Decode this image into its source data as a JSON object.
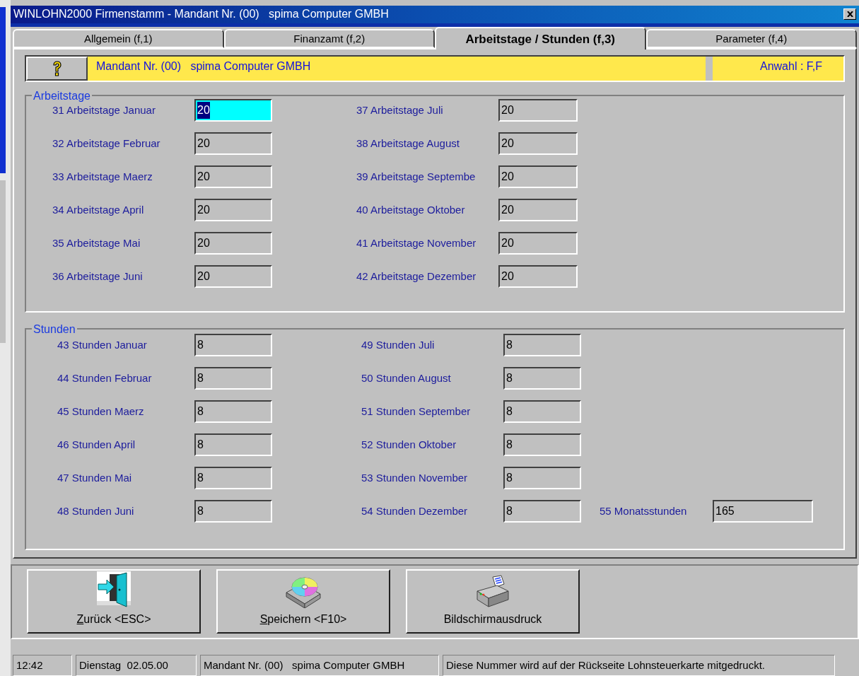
{
  "window": {
    "title": "WINLOHN2000 Firmenstamm - Mandant Nr. (00)   spima Computer GMBH"
  },
  "tabs": [
    {
      "label": "Allgemein (f,1)",
      "selected": false
    },
    {
      "label": "Finanzamt (f,2)",
      "selected": false
    },
    {
      "label": "Arbeitstage / Stunden (f,3)",
      "selected": true
    },
    {
      "label": "Parameter (f,4)",
      "selected": false
    }
  ],
  "info_bar": {
    "text": "Mandant Nr. (00)   spima Computer GMBH",
    "selection": "Anwahl : F,F"
  },
  "groups": [
    {
      "title": "Arbeitstage",
      "columns": [
        [
          {
            "label": "31 Arbeitstage Januar",
            "value": "20",
            "focused": true
          },
          {
            "label": "32 Arbeitstage Februar",
            "value": "20",
            "focused": false
          },
          {
            "label": "33 Arbeitstage Maerz",
            "value": "20",
            "focused": false
          },
          {
            "label": "34 Arbeitstage April",
            "value": "20",
            "focused": false
          },
          {
            "label": "35 Arbeitstage Mai",
            "value": "20",
            "focused": false
          },
          {
            "label": "36 Arbeitstage Juni",
            "value": "20",
            "focused": false
          }
        ],
        [
          {
            "label": "37 Arbeitstage Juli",
            "value": "20",
            "focused": false
          },
          {
            "label": "38 Arbeitstage August",
            "value": "20",
            "focused": false
          },
          {
            "label": "39 Arbeitstage Septembe",
            "value": "20",
            "focused": false
          },
          {
            "label": "40 Arbeitstage Oktober",
            "value": "20",
            "focused": false
          },
          {
            "label": "41 Arbeitstage November",
            "value": "20",
            "focused": false
          },
          {
            "label": "42 Arbeitstage Dezember",
            "value": "20",
            "focused": false
          }
        ]
      ]
    },
    {
      "title": "Stunden",
      "columns": [
        [
          {
            "label": "43 Stunden Januar",
            "value": "8",
            "focused": false
          },
          {
            "label": "44 Stunden Februar",
            "value": "8",
            "focused": false
          },
          {
            "label": "45 Stunden Maerz",
            "value": "8",
            "focused": false
          },
          {
            "label": "46 Stunden April",
            "value": "8",
            "focused": false
          },
          {
            "label": "47 Stunden Mai",
            "value": "8",
            "focused": false
          },
          {
            "label": "48 Stunden Juni",
            "value": "8",
            "focused": false
          }
        ],
        [
          {
            "label": "49 Stunden Juli",
            "value": "8",
            "focused": false
          },
          {
            "label": "50 Stunden August",
            "value": "8",
            "focused": false
          },
          {
            "label": "51 Stunden September",
            "value": "8",
            "focused": false
          },
          {
            "label": "52 Stunden Oktober",
            "value": "8",
            "focused": false
          },
          {
            "label": "53 Stunden November",
            "value": "8",
            "focused": false
          },
          {
            "label": "54 Stunden Dezember",
            "value": "8",
            "focused": false
          }
        ],
        [
          {
            "label": "55 Monatsstunden",
            "value": "165",
            "focused": false
          }
        ]
      ]
    }
  ],
  "buttons": [
    {
      "kind": "back",
      "accel": "Z",
      "label": "urück <ESC>"
    },
    {
      "kind": "save",
      "accel": "S",
      "label": "peichern <F10>"
    },
    {
      "kind": "print",
      "label": "Bildschirmausdruck"
    }
  ],
  "status_bar": [
    "12:42",
    "Dienstag  02.05.00",
    "Mandant Nr. (00)   spima Computer GMBH",
    "Diese Nummer wird auf der Rückseite Lohnsteuerkarte mitgedruckt."
  ]
}
